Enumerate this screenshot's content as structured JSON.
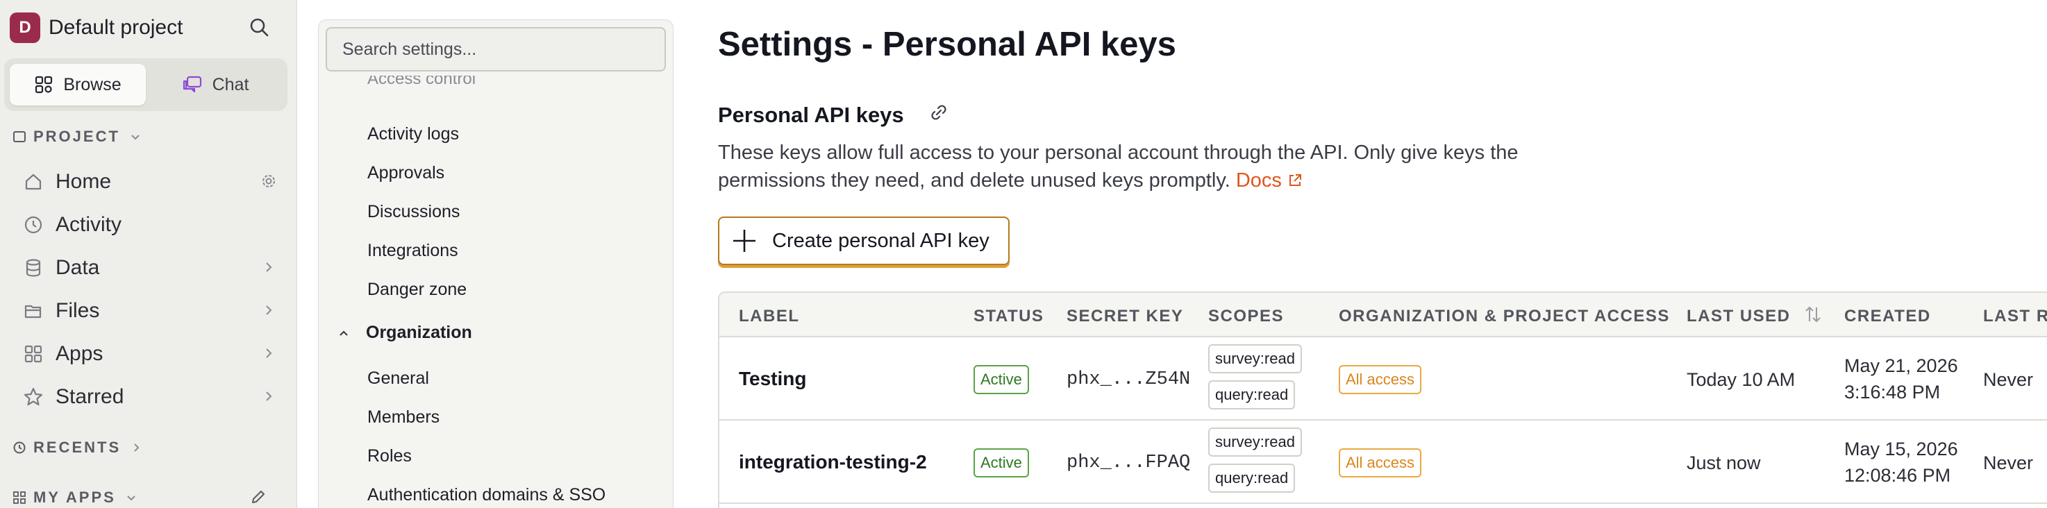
{
  "project": {
    "avatar_letter": "D",
    "name": "Default project"
  },
  "view_toggle": {
    "browse_label": "Browse",
    "chat_label": "Chat"
  },
  "sidebar": {
    "project_header": "PROJECT",
    "items": [
      {
        "label": "Home"
      },
      {
        "label": "Activity"
      },
      {
        "label": "Data"
      },
      {
        "label": "Files"
      },
      {
        "label": "Apps"
      },
      {
        "label": "Starred"
      }
    ],
    "recents_header": "RECENTS",
    "my_apps_header": "MY APPS"
  },
  "settings_menu": {
    "search_placeholder": "Search settings...",
    "cut_item": "Access control",
    "items": [
      "Activity logs",
      "Approvals",
      "Discussions",
      "Integrations",
      "Danger zone"
    ],
    "group_label": "Organization",
    "group_items": [
      "General",
      "Members",
      "Roles",
      "Authentication domains & SSO"
    ]
  },
  "main": {
    "page_title": "Settings - Personal API keys",
    "section_title": "Personal API keys",
    "description": "These keys allow full access to your personal account through the API. Only give keys the permissions they need, and delete unused keys promptly.",
    "docs_link": "Docs",
    "create_button": "Create personal API key"
  },
  "table": {
    "columns": [
      "LABEL",
      "STATUS",
      "SECRET KEY",
      "SCOPES",
      "ORGANIZATION & PROJECT ACCESS",
      "LAST USED",
      "CREATED",
      "LAST ROLLED"
    ],
    "rows": [
      {
        "label": "Testing",
        "status": "Active",
        "secret_key": "phx_...Z54N",
        "scopes": [
          "survey:read",
          "query:read"
        ],
        "access": "All access",
        "last_used": "Today 10 AM",
        "created_date": "May 21, 2026",
        "created_time": "3:16:48 PM",
        "last_rolled": "Never"
      },
      {
        "label": "integration-testing-2",
        "status": "Active",
        "secret_key": "phx_...FPAQ",
        "scopes": [
          "survey:read",
          "query:read"
        ],
        "access": "All access",
        "last_used": "Just now",
        "created_date": "May 15, 2026",
        "created_time": "12:08:46 PM",
        "last_rolled": "Never"
      }
    ]
  },
  "colors": {
    "sidebar_bg": "#eeeeea",
    "project_avatar": "#9a2c4b",
    "docs_link": "#e0561c",
    "create_button_border": "#b9781b",
    "active_badge": "#2d7a22",
    "access_badge": "#d9861a"
  }
}
